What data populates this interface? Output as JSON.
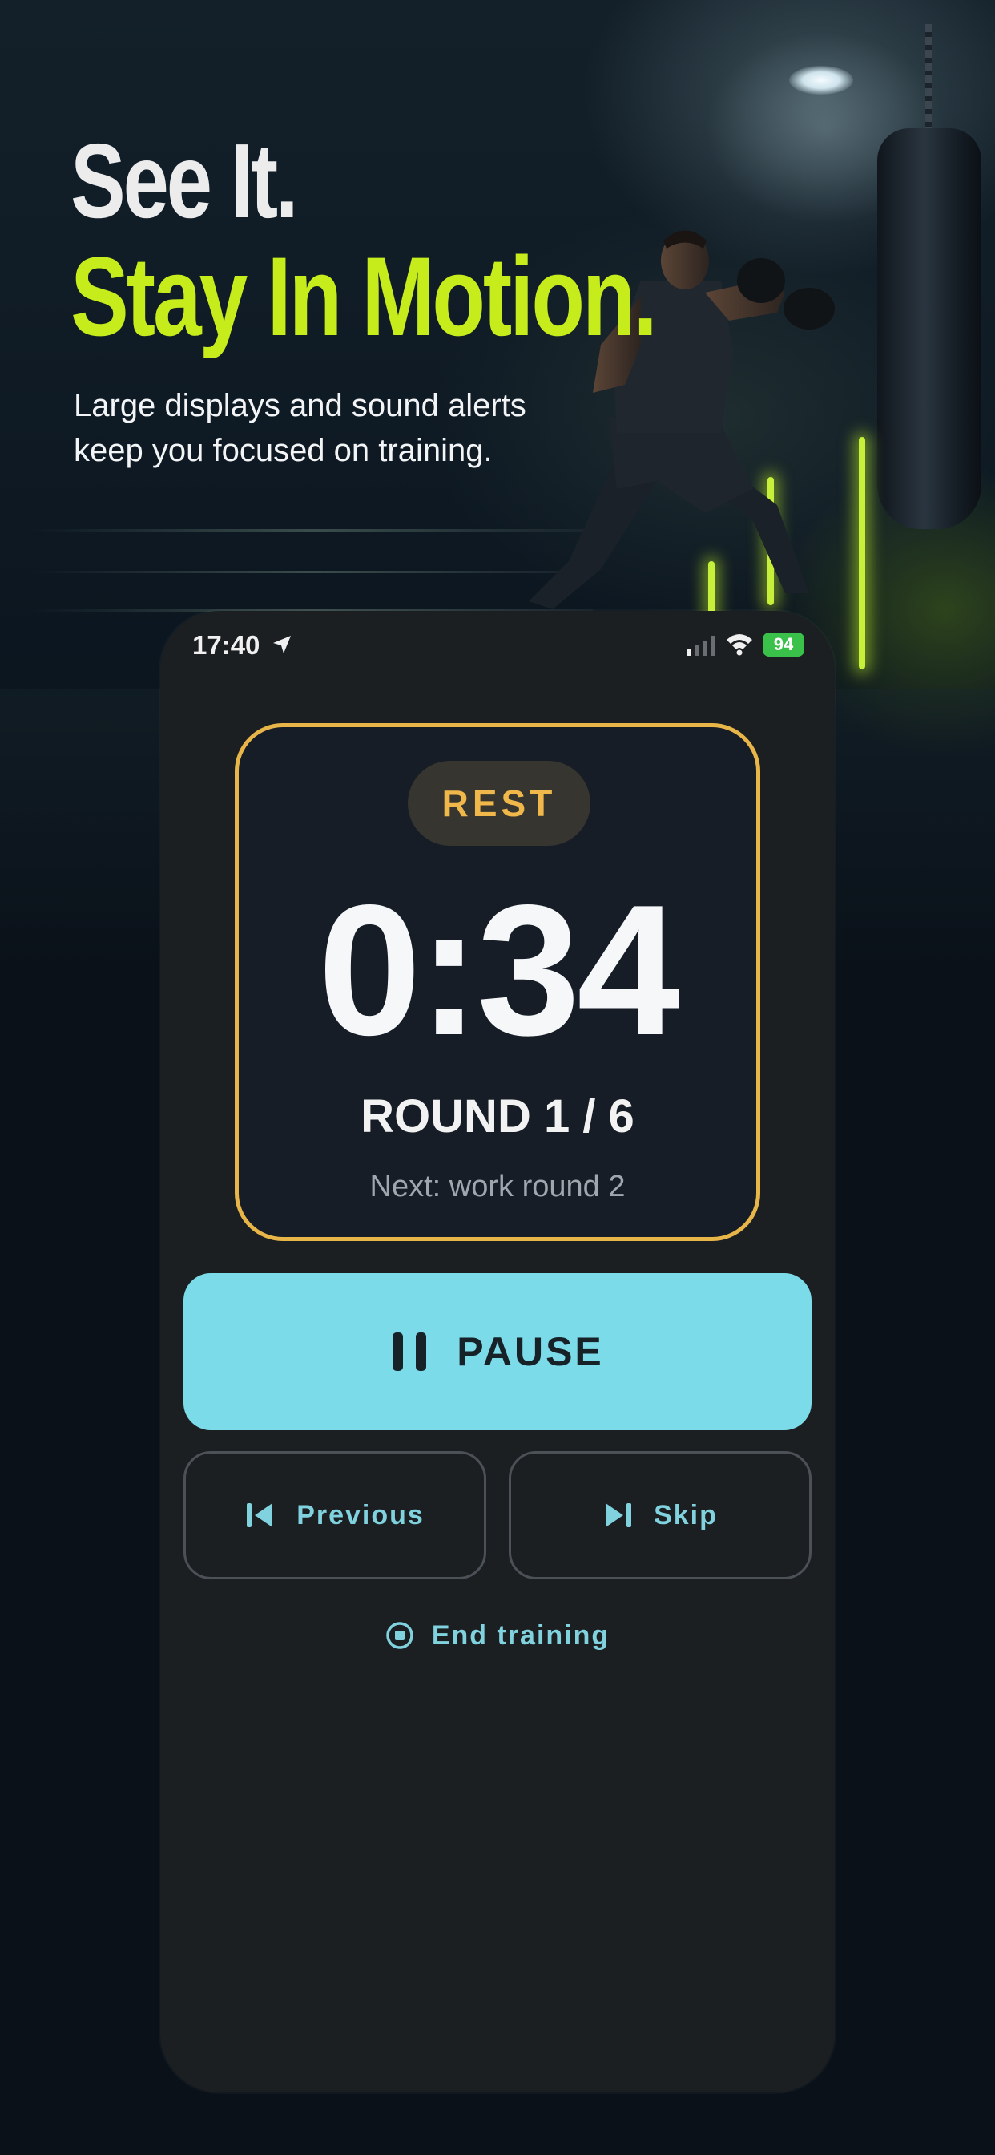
{
  "promo": {
    "headline_line1": "See It.",
    "headline_line2": "Stay In Motion.",
    "subtitle_line1": "Large displays and sound alerts",
    "subtitle_line2": "keep you focused on training."
  },
  "status_bar": {
    "time": "17:40",
    "battery": "94"
  },
  "timer": {
    "phase": "REST",
    "time_remaining": "0:34",
    "round": "ROUND 1 / 6",
    "next": "Next: work round 2"
  },
  "controls": {
    "pause_label": "PAUSE",
    "previous_label": "Previous",
    "skip_label": "Skip",
    "end_label": "End training"
  },
  "colors": {
    "accent_lime": "#c6ec1c",
    "rest_gold": "#e8b548",
    "primary_cyan": "#7bdbe9",
    "secondary_text": "#7fd2de",
    "phone_bg": "#1c1f22",
    "timer_card_bg": "#161d26"
  },
  "icons": {
    "status": [
      "location-arrow-icon",
      "signal-icon",
      "wifi-icon",
      "battery-icon"
    ],
    "pause": "pause-icon",
    "previous": "skip-back-icon",
    "skip": "skip-forward-icon",
    "end": "stop-circle-icon"
  }
}
